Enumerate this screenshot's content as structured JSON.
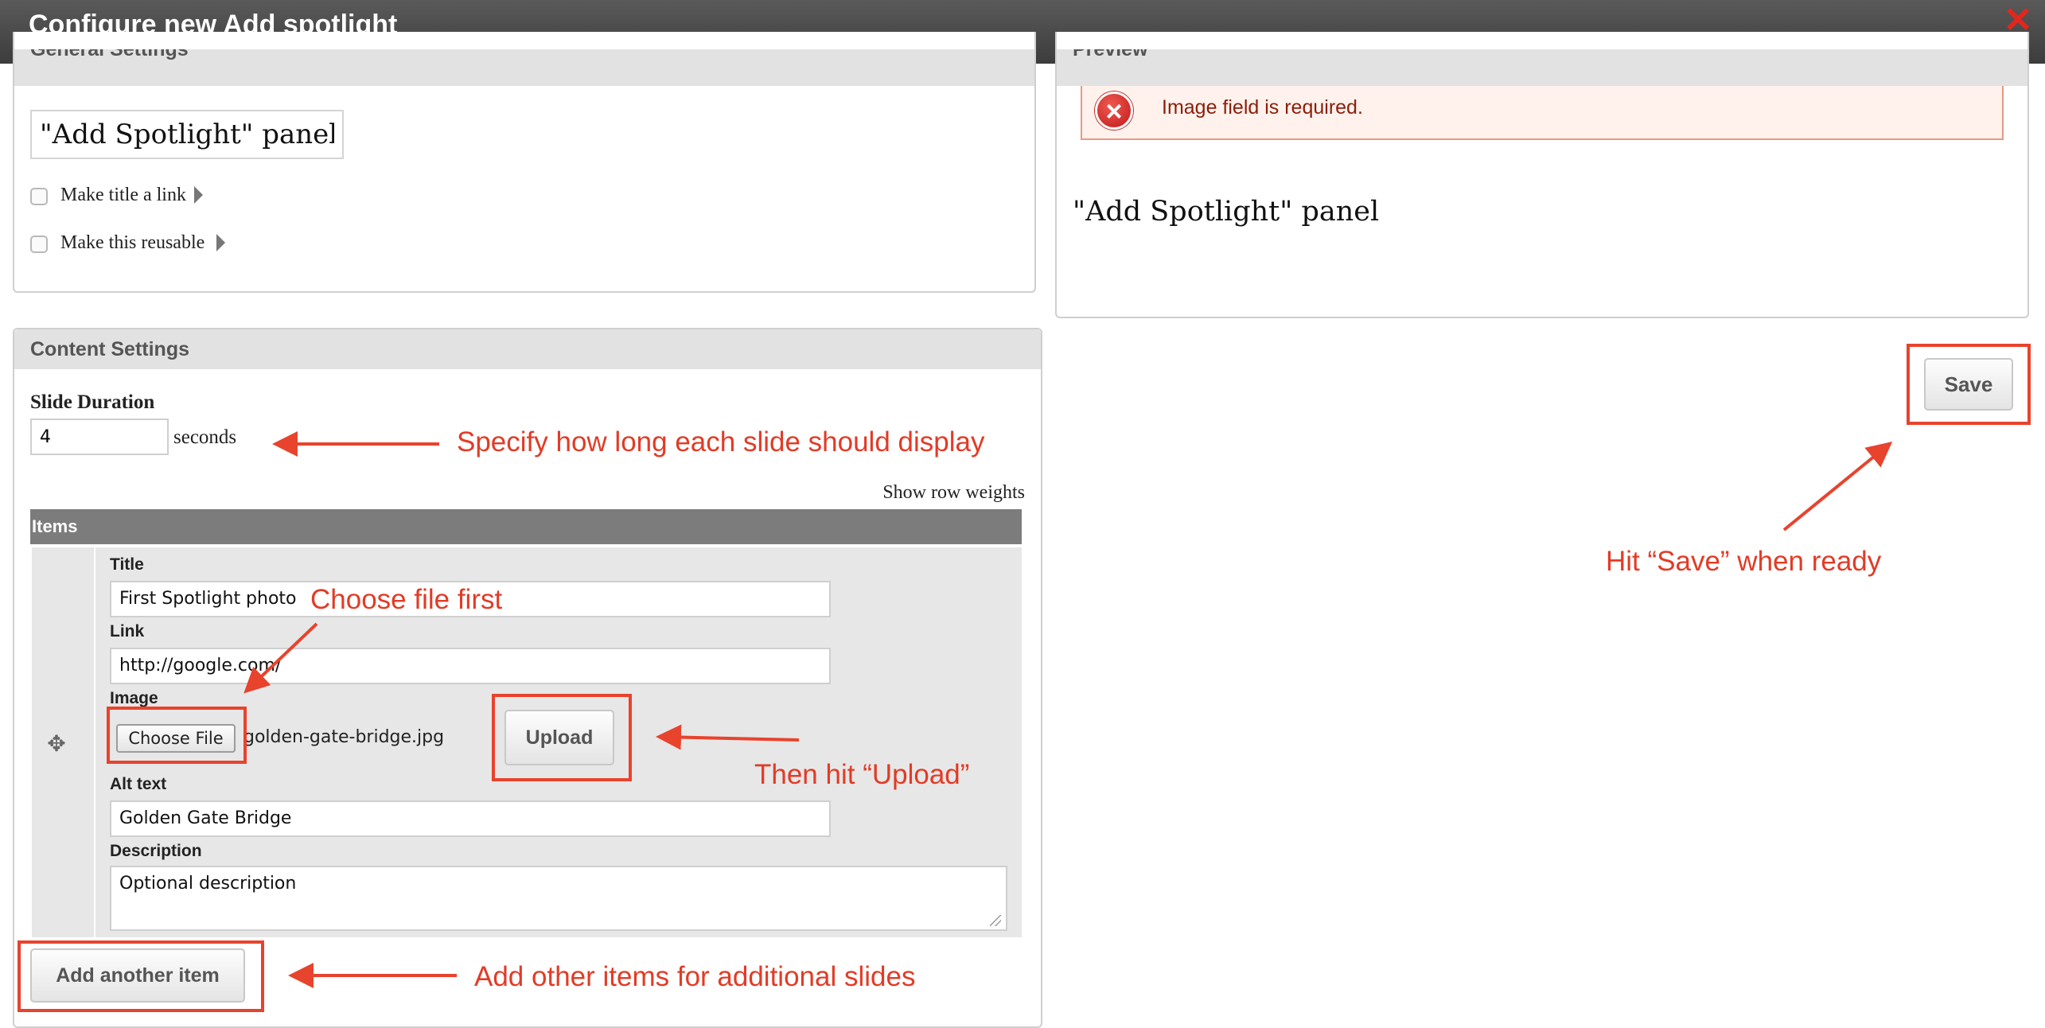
{
  "dialog": {
    "title": "Configure new Add spotlight",
    "close_icon": "close-icon"
  },
  "general_settings": {
    "header": "General Settings",
    "title_value": "\"Add Spotlight\" panel",
    "make_title_link": "Make title a link",
    "make_reusable": "Make this reusable"
  },
  "preview": {
    "header": "Preview",
    "error_message": "Image field is required.",
    "title": "\"Add Spotlight\" panel"
  },
  "content_settings": {
    "header": "Content Settings",
    "slide_duration_label": "Slide Duration",
    "slide_duration_value": "4",
    "seconds_label": "seconds",
    "show_row_weights": "Show row weights",
    "items_header": "Items",
    "item": {
      "title_label": "Title",
      "title_value": "First Spotlight photo",
      "link_label": "Link",
      "link_value": "http://google.com/",
      "image_label": "Image",
      "choose_file_label": "Choose File",
      "file_name": "golden-gate-bridge.jpg",
      "upload_label": "Upload",
      "alt_label": "Alt text",
      "alt_value": "Golden Gate Bridge",
      "description_label": "Description",
      "description_value": "Optional description"
    },
    "add_item_label": "Add another item"
  },
  "save_label": "Save",
  "annotations": {
    "slide_duration": "Specify how long each slide should display",
    "choose_file": "Choose file first",
    "upload": "Then hit “Upload”",
    "add_items": "Add other items for additional slides",
    "save": "Hit “Save” when ready"
  },
  "colors": {
    "annotation_red": "#e8432d",
    "titlebar": "#4a4a4a",
    "error_text": "#8a1f0a"
  }
}
